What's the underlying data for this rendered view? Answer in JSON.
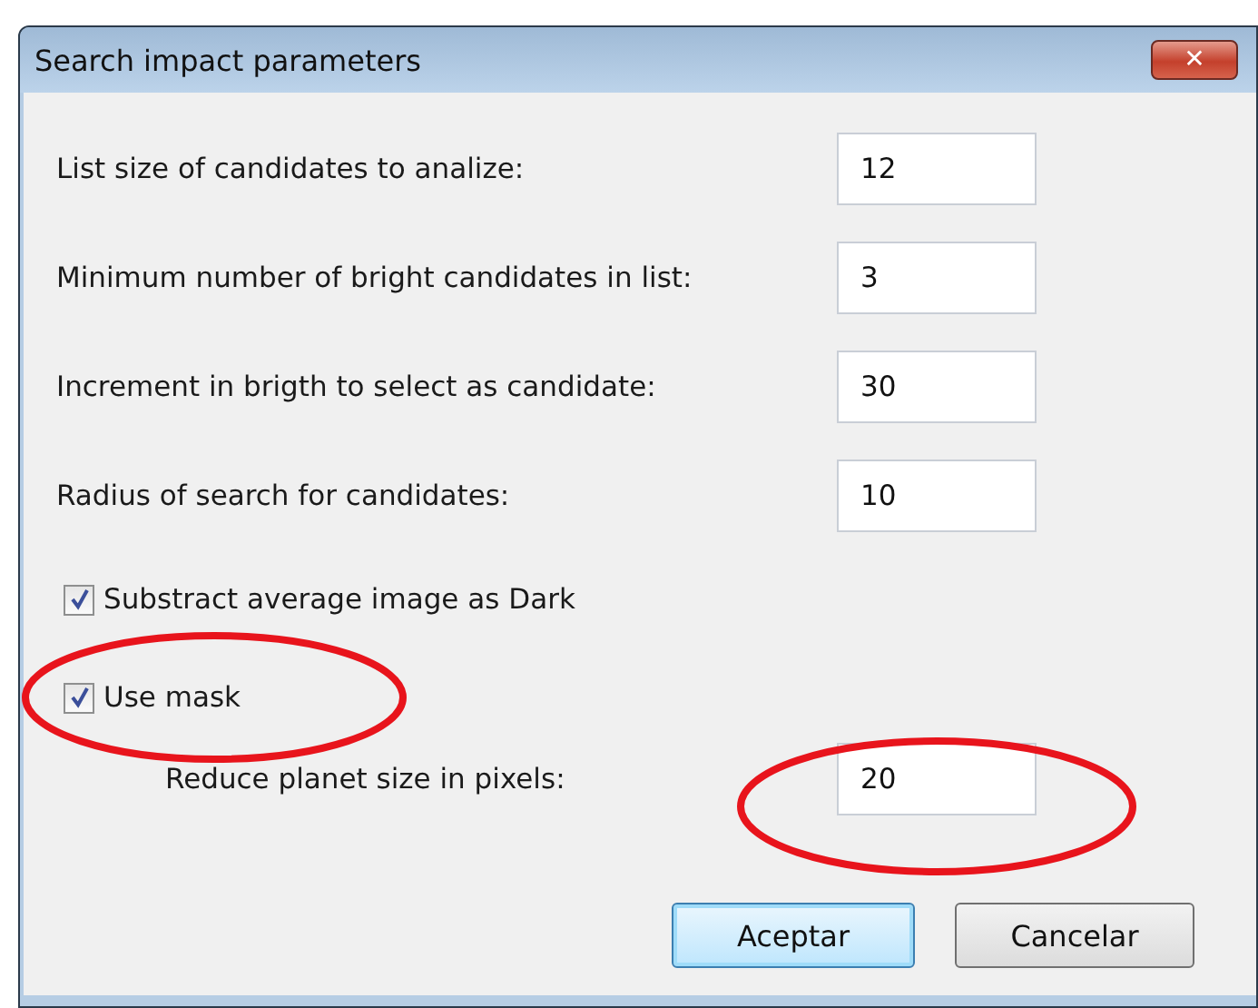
{
  "window": {
    "title": "Search impact parameters",
    "close_label": "✕"
  },
  "fields": [
    {
      "label": "List size of candidates to analize:",
      "value": "12"
    },
    {
      "label": "Minimum number of bright candidates in list:",
      "value": "3"
    },
    {
      "label": "Increment in brigth to select as candidate:",
      "value": "30"
    },
    {
      "label": "Radius of search for candidates:",
      "value": "10"
    }
  ],
  "checkboxes": [
    {
      "label": "Substract average image as Dark",
      "checked": true
    },
    {
      "label": "Use mask",
      "checked": true
    }
  ],
  "mask_field": {
    "label": "Reduce planet size in pixels:",
    "value": "20"
  },
  "buttons": [
    {
      "label": "Aceptar",
      "default": true
    },
    {
      "label": "Cancelar",
      "default": false
    }
  ]
}
